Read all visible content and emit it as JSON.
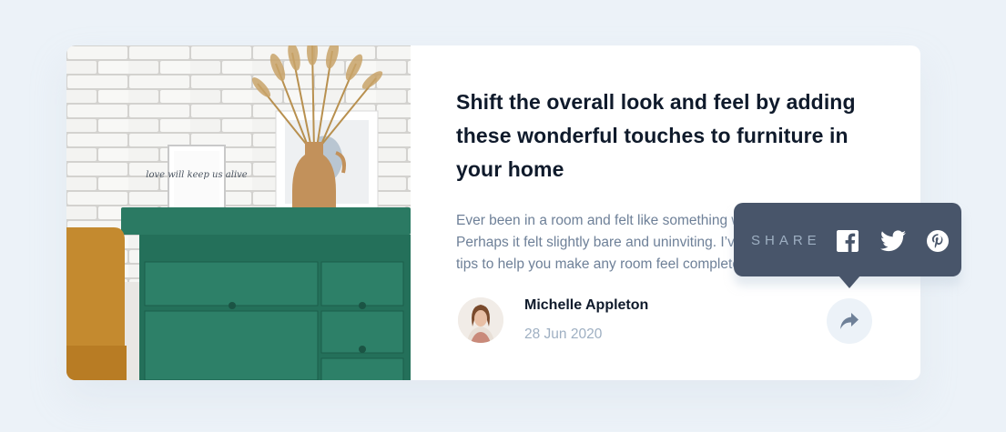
{
  "article": {
    "title": "Shift the overall look and feel by adding these wonderful touches to furniture in your home",
    "excerpt": "Ever been in a room and felt like something was missing? Perhaps it felt slightly bare and uninviting. I’ve got some simple tips to help you make any room feel complete."
  },
  "image": {
    "frame_text": "love will keep us alive"
  },
  "author": {
    "name": "Michelle Appleton",
    "date": "28 Jun 2020"
  },
  "share": {
    "label": "SHARE",
    "icons": [
      "facebook-icon",
      "twitter-icon",
      "pinterest-icon",
      "share-arrow-icon"
    ]
  },
  "colors": {
    "page_bg": "#ecf2f8",
    "card_bg": "#ffffff",
    "title": "#0f1a2b",
    "body_text": "#6e8098",
    "muted": "#9eafc2",
    "popup_bg": "#48556a"
  }
}
